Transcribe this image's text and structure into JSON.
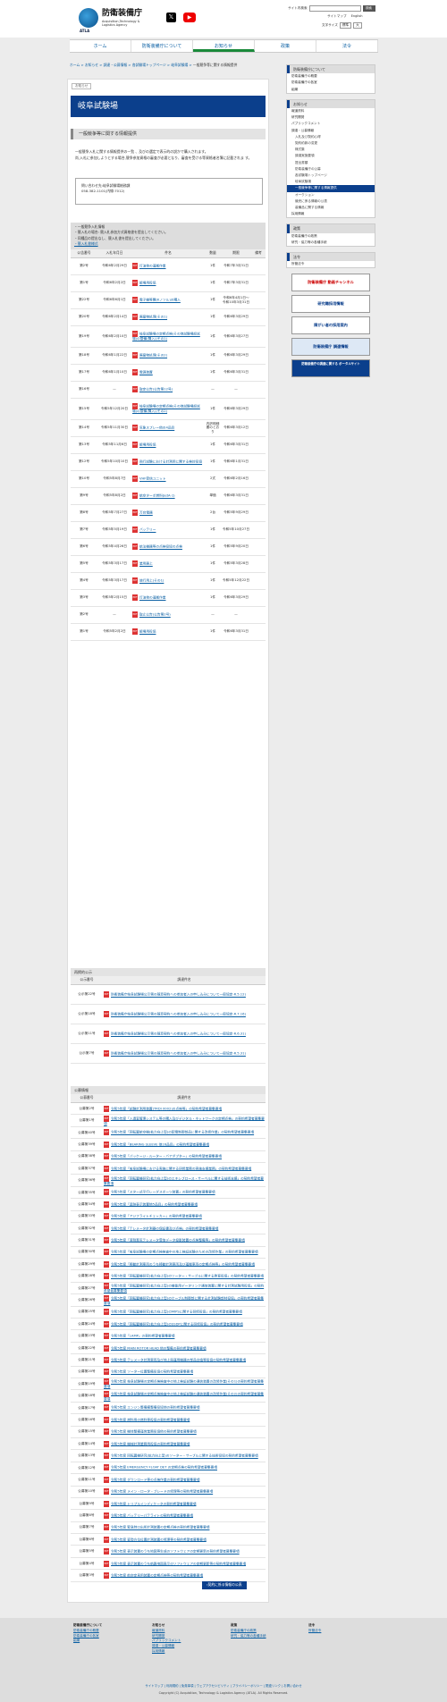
{
  "header": {
    "logo_name": "防衛装備庁",
    "logo_sub1": "Acquisition,Technology &",
    "logo_sub2": "Logistics Agency",
    "logo_abbr": "ATLA",
    "search_label": "サイト内検索",
    "search_button": "検索",
    "sitemap": "サイトマップ",
    "english": "English",
    "font_label": "文字サイズ",
    "font_std": "標準",
    "font_large": "大"
  },
  "gnav": [
    "ホーム",
    "防衛装備庁について",
    "お知らせ",
    "政策",
    "法令"
  ],
  "breadcrumb": [
    "ホーム",
    "お知らせ",
    "調達・公募情報",
    "各試験場トップページ",
    "岐阜試験場",
    "一般競争等に関する情報提供"
  ],
  "main": {
    "tag": "お知らせ",
    "title": "岐阜試験場",
    "section1": "一般競争等に関する情報提供",
    "intro1": "一般競争入札に関する情報提供の一覧 、及びの選定で表示的の説かで購入されます。",
    "intro2": "尚,入札に参加しようとする場合,競争参加資格の審査が必要となり、審査を受ける等資格者名簿に記載されま す。",
    "contact1": "問い合わせ先:岐阜試験場総務課",
    "contact2": "058-382-1101(内線:7012)",
    "caption1": "・一般競争入札情報",
    "caption2": "・競入札の場合: 競入札参加方式資格書を提出してください。",
    "caption3": "・同種品の提出なし、競入札書を提出してください。",
    "caption4": "・競入札書様式",
    "cols": [
      "公告番号",
      "入札年月日",
      "件名",
      "数量",
      "期限",
      "備考"
    ],
    "rows": [
      [
        "第2号",
        "令和6年2月29日",
        "灯油他の運搬作業",
        "1件",
        "令和7年3月31日",
        ""
      ],
      [
        "第1号",
        "令和6年2月2日",
        "飯場用役協",
        "1件",
        "令和7年3月31日",
        ""
      ],
      [
        "第22号",
        "令和6年6月1日",
        "電子機等関(Kノソル)の購入",
        "1件",
        "令和6年4月1日〜令和10年3月31日",
        ""
      ],
      [
        "第20号",
        "令和6年2月14日",
        "廃棄物処理(その1)",
        "1件",
        "令和6年3月29日",
        ""
      ],
      [
        "第19号",
        "令和6年2月10日",
        "岐阜試験場の定期点検(その他試験場設試場)の整備(購入)(その1)",
        "1件",
        "令和6年3月27日",
        ""
      ],
      [
        "第18号",
        "令和6年1月22日",
        "廃棄物処理(その2)",
        "1件",
        "令和6年3月29日",
        ""
      ],
      [
        "第17号",
        "令和6年1月10日",
        "電源装置",
        "1件",
        "令和6年3月31日",
        ""
      ],
      [
        "第16号",
        "—",
        "取定公告(公告第12号)",
        "—",
        "—",
        ""
      ],
      [
        "第15号",
        "令和5年12月20日",
        "岐阜試験場の定期点検(その他試験場設試場)の整備(購入)(その2)",
        "1件",
        "令和6年3月29日",
        ""
      ],
      [
        "第14号",
        "令和5年11月30日",
        "気象スプレー他の4品目",
        "内訳明細書のとおり",
        "令和6年3月12日",
        ""
      ],
      [
        "第13号",
        "令和5年11月6日",
        "飯場用役協",
        "1件",
        "令和6年3月31日",
        ""
      ],
      [
        "第12号",
        "令和5年10月10日",
        "飛行試験における計測用に関する検討役協",
        "1件",
        "令和6年1月31日",
        ""
      ],
      [
        "第10号",
        "令和5年8月7日",
        "VHF受信ユニット",
        "2式",
        "令和6年2月16日",
        ""
      ],
      [
        "第9号",
        "令和5年8月2日",
        "航空ターボ燃料(JetA-1)",
        "単価",
        "令和6年3月31日",
        ""
      ],
      [
        "第8号",
        "令和5年7月27日",
        "万台電器",
        "2台",
        "令和5年9月29日",
        ""
      ],
      [
        "第7号",
        "令和5年5月19日",
        "バッテリー",
        "1件",
        "令和5年10月27日",
        ""
      ],
      [
        "第6号",
        "令和5年4月26日",
        "航法機器等の点検役協の点検",
        "1件",
        "令和5年9月20日",
        ""
      ],
      [
        "第5号",
        "令和5年3月17日",
        "業用器上",
        "1件",
        "令和5年3月28日",
        ""
      ],
      [
        "第4号",
        "令和5年3月17日",
        "旅行用上(その1)",
        "1件",
        "令和5年12月22日",
        ""
      ],
      [
        "第3号",
        "令和5年2月15日",
        "灯油他の運搬作業",
        "1件",
        "令和6年3月29日",
        ""
      ],
      [
        "第2号",
        "—",
        "取止公告(公告第2号)",
        "—",
        "—",
        ""
      ],
      [
        "第1号",
        "令和5年2月2日",
        "飯場用役協",
        "1件",
        "令和6年3月31日",
        ""
      ]
    ],
    "sec2_caption": "再掲的公示",
    "sec2_cols": [
      "公示番号",
      "調達件名"
    ],
    "sec2_rows": [
      [
        "公示第22号",
        "防衛装備庁岐阜試験場公示第の随意契約への参加者入の申し込みについて一般協定-R.5.12)"
      ],
      [
        "公示第18号",
        "防衛装備庁岐阜試験場公示第の随意契約への参加者入の申し込みについて一般協定-R.7.16)"
      ],
      [
        "公示第11号",
        "防衛装備庁岐阜試験場公示第の随意契約への参加者入の申し込みについて一般協定-R.6.31)"
      ],
      [
        "公示第7号",
        "防衛装備庁岐阜試験場公示第の随意契約への参加者入の申し込みについて一般協定-R.5.31)"
      ]
    ],
    "sec3_caption": "公募情報",
    "sec3_cols": [
      "公募番号",
      "調達件名"
    ],
    "sec3_rows": [
      [
        "公募第2号",
        "令和5年度「試験計測用装置(TRDI 0002)の点検等」の契約希望者募集要項"
      ],
      [
        "公募第1号",
        "令和5年度「入退室管理システム等の購入及びデジタル・ネットワークの定期点検」の契約希望者募集要項"
      ],
      [
        "公募第40号",
        "令和5年度「回転翼航空機(拡力向上型)の配電制御部品に関する改修作業」の契約希望者募集要項"
      ],
      [
        "公募第39号",
        "令和5年度「BEARING SLEEVE 他16品目」の契約希望者募集要項"
      ],
      [
        "公募第38号",
        "令和5年度「パッケージ・ルーター・バアダプター」の契約希望者募集要項"
      ],
      [
        "公募第37号",
        "令和5年度「岐阜試験場における実施に関する研修業務の実施支援業務」の契約希望者募集要項"
      ],
      [
        "公募第36号",
        "令和5年度「回転翼機研究(拡力向上型)のエキシブロース・サーベルに関する技術支援」の契約希望者募集要項"
      ],
      [
        "公募第35号",
        "令和5年度「スター式平行レーダスポーツ装置」の契約希望者募集要項"
      ],
      [
        "公募第34号",
        "令和5年度「追跡表示装置他5品目」の契約希望者募集要項"
      ],
      [
        "公募第33号",
        "令和5年度「アジフライトチェッカー」の契約希望者募集要項"
      ],
      [
        "公募第32号",
        "令和5年度「テレメータ計測器の保証書及び点検」の契約希望者募集要項"
      ],
      [
        "公募第31号",
        "令和5年度「溶剤蒸気テレメータ受信データ投影装置の点検整備等」の契約希望者募集要項"
      ],
      [
        "公募第30号",
        "令和5年度「岐阜試験場の定期点検検査中の地上検証試験のための改修作業」の契約希望者募集要項"
      ],
      [
        "公募第29号",
        "令和5年度「移動計測車両のうち移動計測車両及び運搬車両の定期点検等」の契約希望者募集要項"
      ],
      [
        "公募第28号",
        "令和5年度「回転翼機研究(拡力向上型)のソーター・サーブルに関する教育役協」の契約希望者募集要項"
      ],
      [
        "公募第27号",
        "令和5年度「回転翼機研究(拡力向上型)の機能用データリンク通信装置に関する計測試験用役協」の契約希望者募集要項"
      ],
      [
        "公募第26号",
        "令和5年度「回転翼機研究(拡力向上型)のケーブル制御部に関する計測試験部材役協」の契約希望者募集要項"
      ],
      [
        "公募第25号",
        "令和5年度「回転翼機研究(拡力向上型)のMIPSに関する研修役協」の契約希望者募集要項"
      ],
      [
        "公募第24号",
        "令和5年度「回転翼機研究(拡力向上型)のSSDPに関する研修役協」の契約希望者募集要項"
      ],
      [
        "公募第23号",
        "令和5年度「LAMP」の契約希望者募集要項"
      ],
      [
        "公募第22号",
        "令和5年度 MAIN ROTOR HEAD 他の整備の契約希望者募集要項"
      ],
      [
        "公募第21号",
        "令和5年度 テレメータ計測車両及び地上局運用機器の部品交換等役協の契約希望者募集要項"
      ],
      [
        "公募第20号",
        "令和5年度 ソーター位置整備役協の契約希望者募集要項"
      ],
      [
        "公募第19号",
        "令和5年度 岐阜試験場の定期点検検査中の地上検証試験の通信装置の改修作業(その1)の契約希望者募集要項"
      ],
      [
        "公募第18号",
        "令和5年度 岐阜試験場の定期点検検査中の地上検証試験の通信装置の改修作業(その2)の契約希望者募集要項"
      ],
      [
        "公募第17号",
        "令和5年度 エンジン整備備整備役協他の契約希望者募集要項"
      ],
      [
        "公募第16号",
        "令和5年度 燃料用の燃料等役協の契約希望者募集要項"
      ],
      [
        "公募第15号",
        "令和5年度 機体整備運営業務役協他の契約希望者募集要項"
      ],
      [
        "公募第14号",
        "令和5年度 機械計測業務用役協の契約希望者募集要項"
      ],
      [
        "公募第13号",
        "令和5年度 回転翼機研究(拡力向上型)のソーター・サーブルに関する技術役協の契約希望者募集要項"
      ],
      [
        "公募第12号",
        "令和5年度 EMERGENCY FLOAT DET の定期点検の契約希望者募集要項"
      ],
      [
        "公募第11号",
        "令和5年度 ダウンロード等の点検作業の契約希望者募集要項"
      ],
      [
        "公募第10号",
        "令和5年度 メイン・ロータ・ブレードの修理等の契約希望者募集要項"
      ],
      [
        "公募第9号",
        "令和5年度 トリプルインディケータの契約希望者募集要項"
      ],
      [
        "公募第8号",
        "令和5年度 バッテリーパテライトの契約希望者募集要項"
      ],
      [
        "公募第7号",
        "令和5年度 緊急時ロ出所計測装置の定期点検の契約希望者募集要項"
      ],
      [
        "公募第6号",
        "令和5年度 姿勢方位位置計測装置の修理等の契約希望者募集要項"
      ],
      [
        "公募第5号",
        "令和5年度 表示装置のうち地図等生成のソフトウェアの定期更新の契約希望者募集要項"
      ],
      [
        "公募第4号",
        "令和5年度 表示装置のうち航路地図表示のソフトウェアの定期更新等の契約希望者募集要項"
      ],
      [
        "公募第3号",
        "令和5年度 航空定見用装置の定期点検等の契約希望者募集要項"
      ]
    ],
    "list_link": "›契約に係る情報の公表"
  },
  "side": {
    "box1_h": "防衛装備庁について",
    "box1": [
      "防衛装備庁の概要",
      "防衛装備庁の各室",
      "組織"
    ],
    "box2_h": "お知らせ",
    "box2": [
      "報道資料",
      "研究開発",
      "パブリックコメント",
      "調達・公募情報"
    ],
    "box2_sub": [
      "入札及び契約心得",
      "契約約款の変更",
      "様式集",
      "調達実施要領",
      "提出書類",
      "防衛装備庁の公募",
      "各試験場トップページ",
      "岐阜試験場"
    ],
    "current": "一般競争等に関する情報提供",
    "box2_sub2": [
      "オークション",
      "競売に係る情報の公表",
      "装備品に関する情報",
      "採用情報"
    ],
    "box3_h": "政策",
    "box3": [
      "防衛装備庁の政策",
      "研究・協力等の各種手続"
    ],
    "box4_h": "法令",
    "box4": [
      "所管法令"
    ],
    "banners": [
      "防衛装備庁 動画チャンネル",
      "研究職採用情報",
      "障がい者の採用案内",
      "防衛装備庁 調達情報",
      "防衛装備庁の調達に関する ポータルサイト"
    ]
  },
  "footer": {
    "col1_h": "防衛装備庁について",
    "col1": [
      "防衛装備庁の概要",
      "防衛装備庁の各室",
      "組織"
    ],
    "col2_h": "お知らせ",
    "col2": [
      "報道資料",
      "研究開発",
      "パブリックコメント",
      "調達・公募情報",
      "採用情報"
    ],
    "col3_h": "政策",
    "col3": [
      "防衛装備庁の政策",
      "研究・協力等の各種手続"
    ],
    "col4_h": "法令",
    "col4": [
      "所管法令"
    ],
    "links": "サイトマップ | 利用規約 | 免責事項 | ウェブアクセシビリティ | プライバシーポリシー | 関連リンク | お問い合わせ",
    "copyright": "Copyright (C) Acquisition, Technology & Logistics Agency (ATLA). All Rights Reserved."
  },
  "colors": {
    "brand": "#0b3f8c",
    "link": "#0a5fa3",
    "accent": "#1a8a3a"
  }
}
